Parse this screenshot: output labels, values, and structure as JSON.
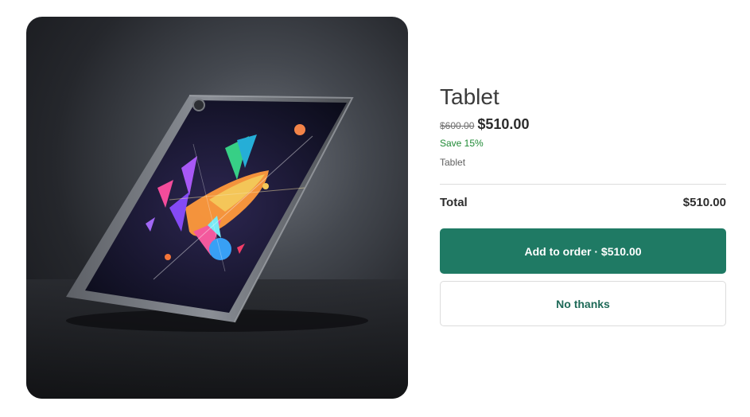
{
  "product": {
    "title": "Tablet",
    "original_price": "$600.00",
    "sale_price": "$510.00",
    "savings": "Save 15%",
    "variant": "Tablet",
    "image_alt": "tablet product photo"
  },
  "order": {
    "total_label": "Total",
    "total_value": "$510.00"
  },
  "actions": {
    "add_label": "Add to order · $510.00",
    "decline_label": "No thanks"
  },
  "colors": {
    "primary_button": "#1f7a64",
    "secondary_text": "#1f6a58",
    "savings_text": "#1f8a35"
  }
}
